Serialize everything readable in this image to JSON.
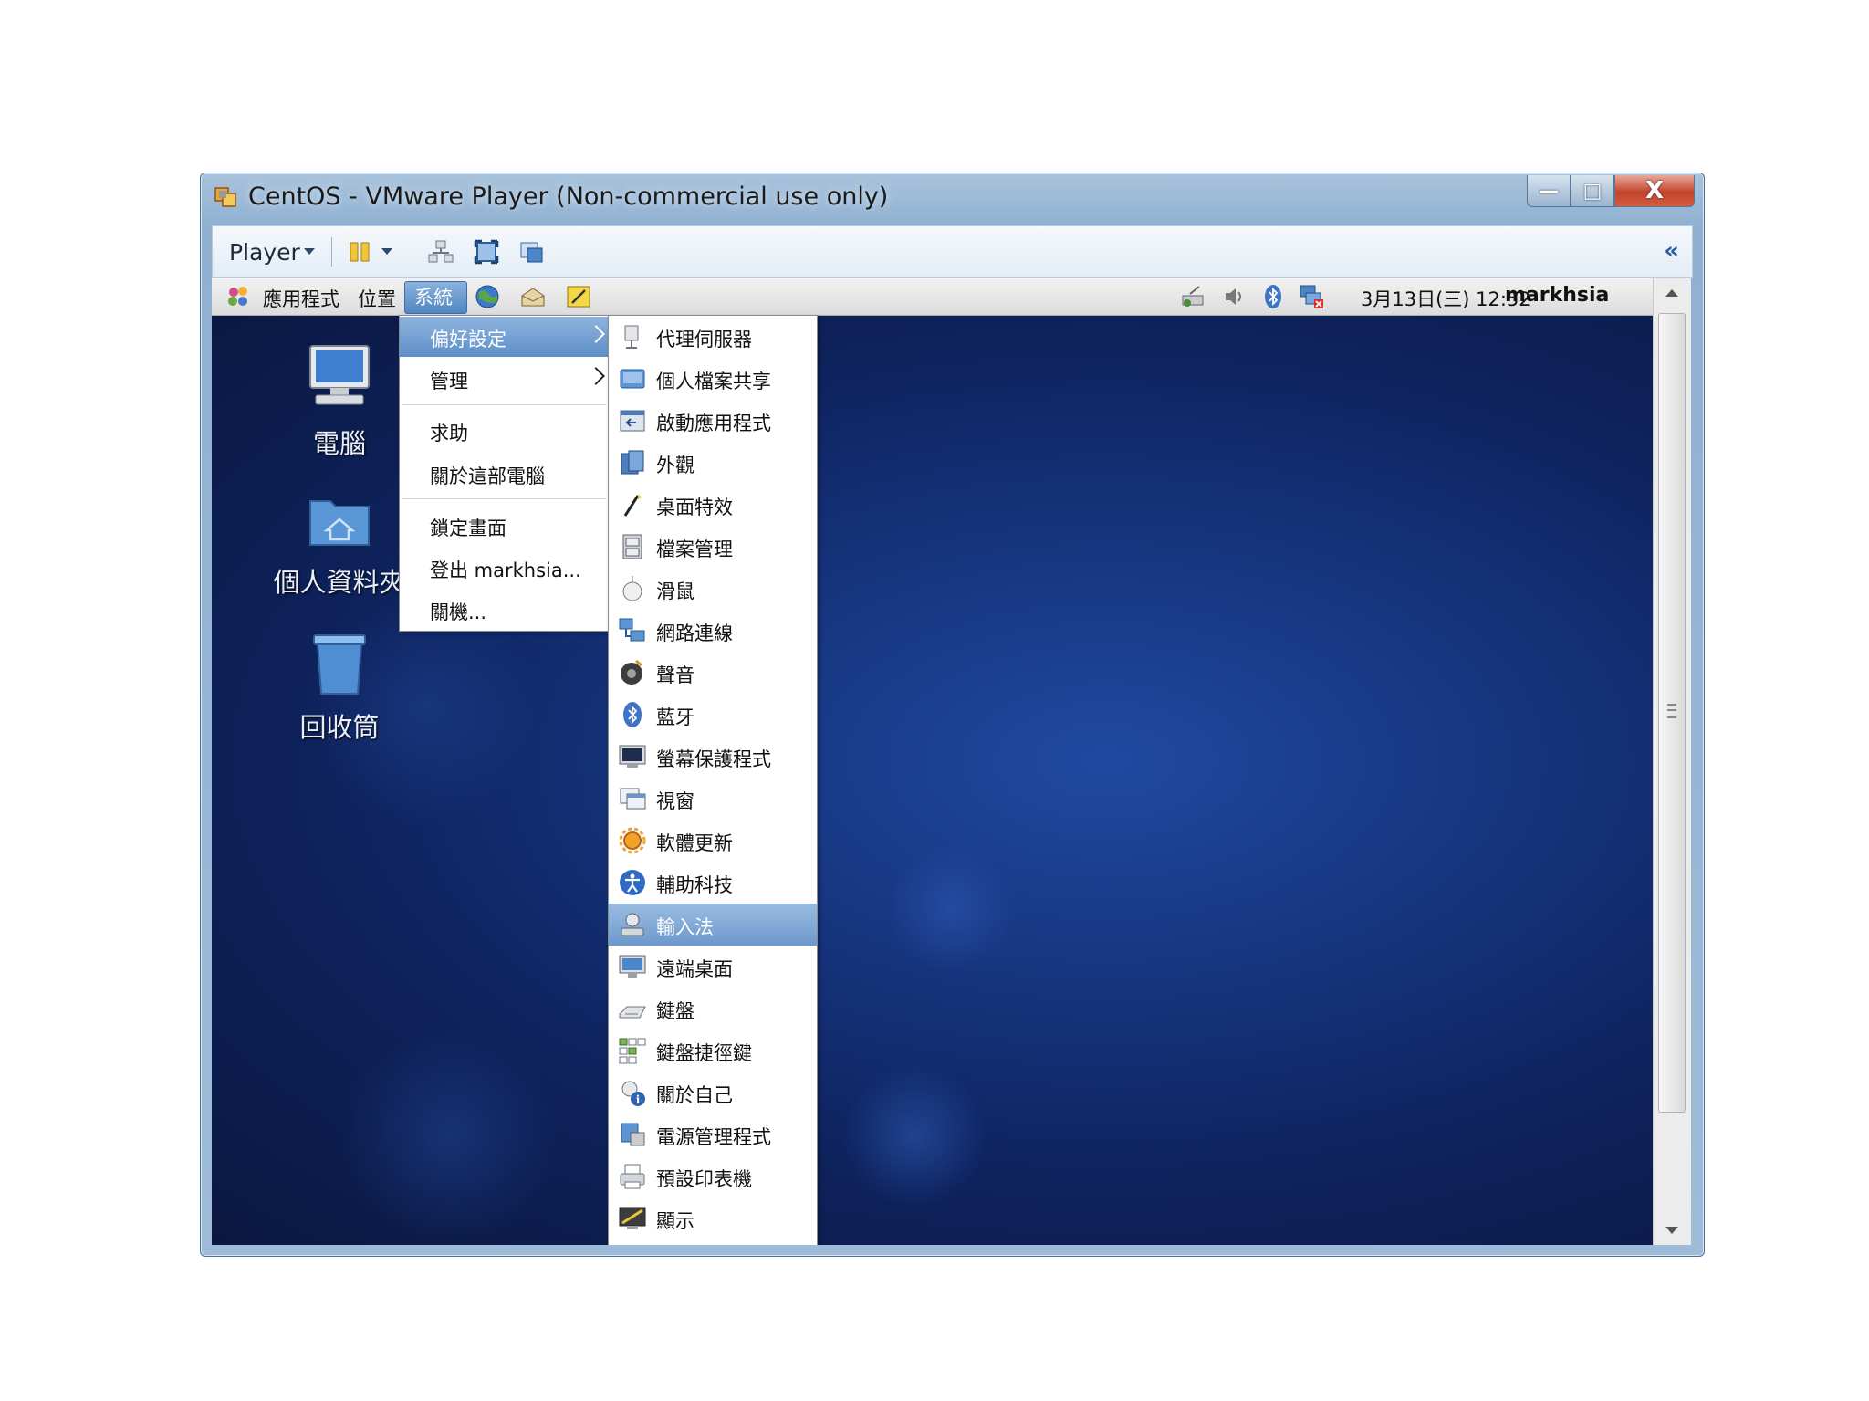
{
  "window": {
    "title": "CentOS - VMware Player (Non-commercial use only)",
    "controls": {
      "minimize": "—",
      "maximize": "□",
      "close": "X"
    }
  },
  "toolbar": {
    "player_label": "Player",
    "collapse_label": "«"
  },
  "panel": {
    "applications": "應用程式",
    "places": "位置",
    "system": "系統",
    "clock": "3月13日(三) 12:52",
    "user": "markhsia"
  },
  "desktop": {
    "icons": [
      {
        "label": "電腦"
      },
      {
        "label": "個人資料夾"
      },
      {
        "label": "回收筒"
      }
    ]
  },
  "system_menu": {
    "items": [
      {
        "label": "偏好設定",
        "submenu": true,
        "highlighted": true
      },
      {
        "label": "管理",
        "submenu": true
      },
      {
        "label": "求助"
      },
      {
        "label": "關於這部電腦"
      },
      {
        "label": "鎖定畫面"
      },
      {
        "label": "登出 markhsia..."
      },
      {
        "label": "關機..."
      }
    ]
  },
  "preferences_menu": {
    "items": [
      {
        "label": "代理伺服器",
        "icon": "proxy-icon"
      },
      {
        "label": "個人檔案共享",
        "icon": "file-share-icon"
      },
      {
        "label": "啟動應用程式",
        "icon": "startup-apps-icon"
      },
      {
        "label": "外觀",
        "icon": "appearance-icon"
      },
      {
        "label": "桌面特效",
        "icon": "desktop-effects-icon"
      },
      {
        "label": "檔案管理",
        "icon": "file-manager-icon"
      },
      {
        "label": "滑鼠",
        "icon": "mouse-icon"
      },
      {
        "label": "網路連線",
        "icon": "network-icon"
      },
      {
        "label": "聲音",
        "icon": "sound-icon"
      },
      {
        "label": "藍牙",
        "icon": "bluetooth-icon"
      },
      {
        "label": "螢幕保護程式",
        "icon": "screensaver-icon"
      },
      {
        "label": "視窗",
        "icon": "windows-icon"
      },
      {
        "label": "軟體更新",
        "icon": "software-update-icon"
      },
      {
        "label": "輔助科技",
        "icon": "accessibility-icon"
      },
      {
        "label": "輸入法",
        "icon": "input-method-icon",
        "highlighted": true
      },
      {
        "label": "遠端桌面",
        "icon": "remote-desktop-icon"
      },
      {
        "label": "鍵盤",
        "icon": "keyboard-icon"
      },
      {
        "label": "鍵盤捷徑鍵",
        "icon": "keyboard-shortcuts-icon"
      },
      {
        "label": "關於自己",
        "icon": "about-me-icon"
      },
      {
        "label": "電源管理程式",
        "icon": "power-manager-icon"
      },
      {
        "label": "預設印表機",
        "icon": "printer-icon"
      },
      {
        "label": "顯示",
        "icon": "display-icon"
      }
    ]
  },
  "colors": {
    "menu_highlight": "#6c98cc",
    "desktop_blue": "#16357f",
    "panel_gray": "#dcdcdc"
  }
}
